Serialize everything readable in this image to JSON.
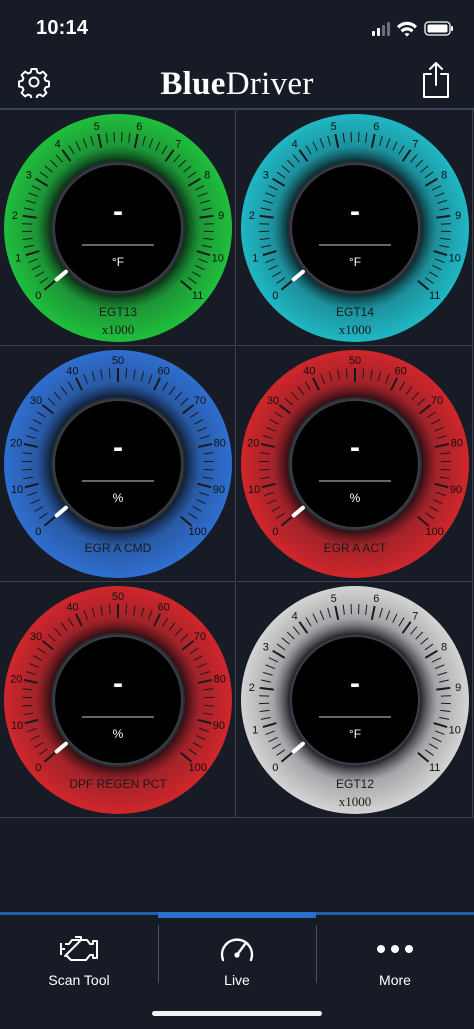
{
  "status_bar": {
    "time": "10:14"
  },
  "header": {
    "brand_bold": "Blue",
    "brand_regular": "Driver"
  },
  "gauges": [
    {
      "name": "EGT13",
      "multiplier": "x1000",
      "value": "-",
      "unit": "°F",
      "ticks": [
        "0",
        "1",
        "2",
        "3",
        "4",
        "5",
        "6",
        "7",
        "8",
        "9",
        "10",
        "11"
      ],
      "color": "#1fbf3c"
    },
    {
      "name": "EGT14",
      "multiplier": "x1000",
      "value": "-",
      "unit": "°F",
      "ticks": [
        "0",
        "1",
        "2",
        "3",
        "4",
        "5",
        "6",
        "7",
        "8",
        "9",
        "10",
        "11"
      ],
      "color": "#1fb8c4"
    },
    {
      "name": "EGR A CMD",
      "multiplier": "",
      "value": "-",
      "unit": "%",
      "ticks": [
        "0",
        "10",
        "20",
        "30",
        "40",
        "50",
        "60",
        "70",
        "80",
        "90",
        "100"
      ],
      "color": "#2f6fd0"
    },
    {
      "name": "EGR A ACT",
      "multiplier": "",
      "value": "-",
      "unit": "%",
      "ticks": [
        "0",
        "10",
        "20",
        "30",
        "40",
        "50",
        "60",
        "70",
        "80",
        "90",
        "100"
      ],
      "color": "#d0262b"
    },
    {
      "name": "DPF REGEN PCT",
      "multiplier": "",
      "value": "-",
      "unit": "%",
      "ticks": [
        "0",
        "10",
        "20",
        "30",
        "40",
        "50",
        "60",
        "70",
        "80",
        "90",
        "100"
      ],
      "color": "#d0262b"
    },
    {
      "name": "EGT12",
      "multiplier": "x1000",
      "value": "-",
      "unit": "°F",
      "ticks": [
        "0",
        "1",
        "2",
        "3",
        "4",
        "5",
        "6",
        "7",
        "8",
        "9",
        "10",
        "11"
      ],
      "color": "#d4d4d4"
    }
  ],
  "tabs": [
    {
      "label": "Scan Tool",
      "icon": "engine-icon",
      "active": false
    },
    {
      "label": "Live",
      "icon": "speedometer-icon",
      "active": true
    },
    {
      "label": "More",
      "icon": "more-dots-icon",
      "active": false
    }
  ]
}
